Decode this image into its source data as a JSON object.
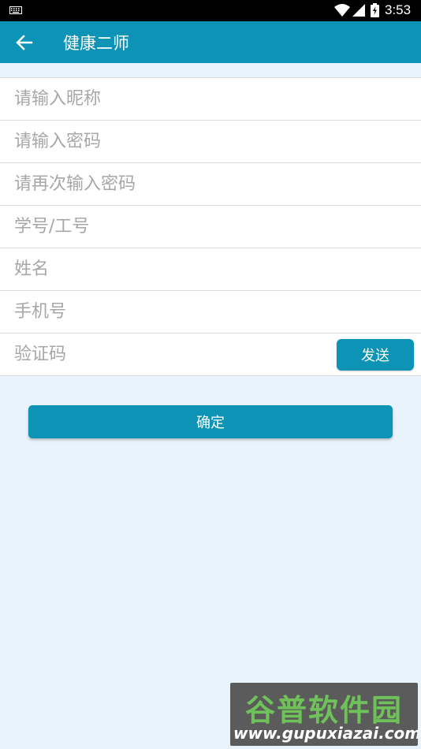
{
  "status_bar": {
    "time": "3:53",
    "icons": [
      "keyboard-icon",
      "wifi-icon",
      "signal-icon",
      "battery-icon"
    ]
  },
  "app_bar": {
    "title": "健康二师",
    "back_icon": "arrow-left-icon",
    "color": "#0d93b5"
  },
  "form": {
    "fields": [
      {
        "name": "nickname",
        "placeholder": "请输入昵称",
        "value": ""
      },
      {
        "name": "password",
        "placeholder": "请输入密码",
        "value": ""
      },
      {
        "name": "confirm-password",
        "placeholder": "请再次输入密码",
        "value": ""
      },
      {
        "name": "student-staff-id",
        "placeholder": "学号/工号",
        "value": ""
      },
      {
        "name": "full-name",
        "placeholder": "姓名",
        "value": ""
      },
      {
        "name": "phone",
        "placeholder": "手机号",
        "value": ""
      },
      {
        "name": "verification-code",
        "placeholder": "验证码",
        "value": ""
      }
    ],
    "send_label": "发送",
    "confirm_label": "确定"
  },
  "watermark": {
    "title": "谷普软件园",
    "url": "www.gupuxiazai.com"
  }
}
